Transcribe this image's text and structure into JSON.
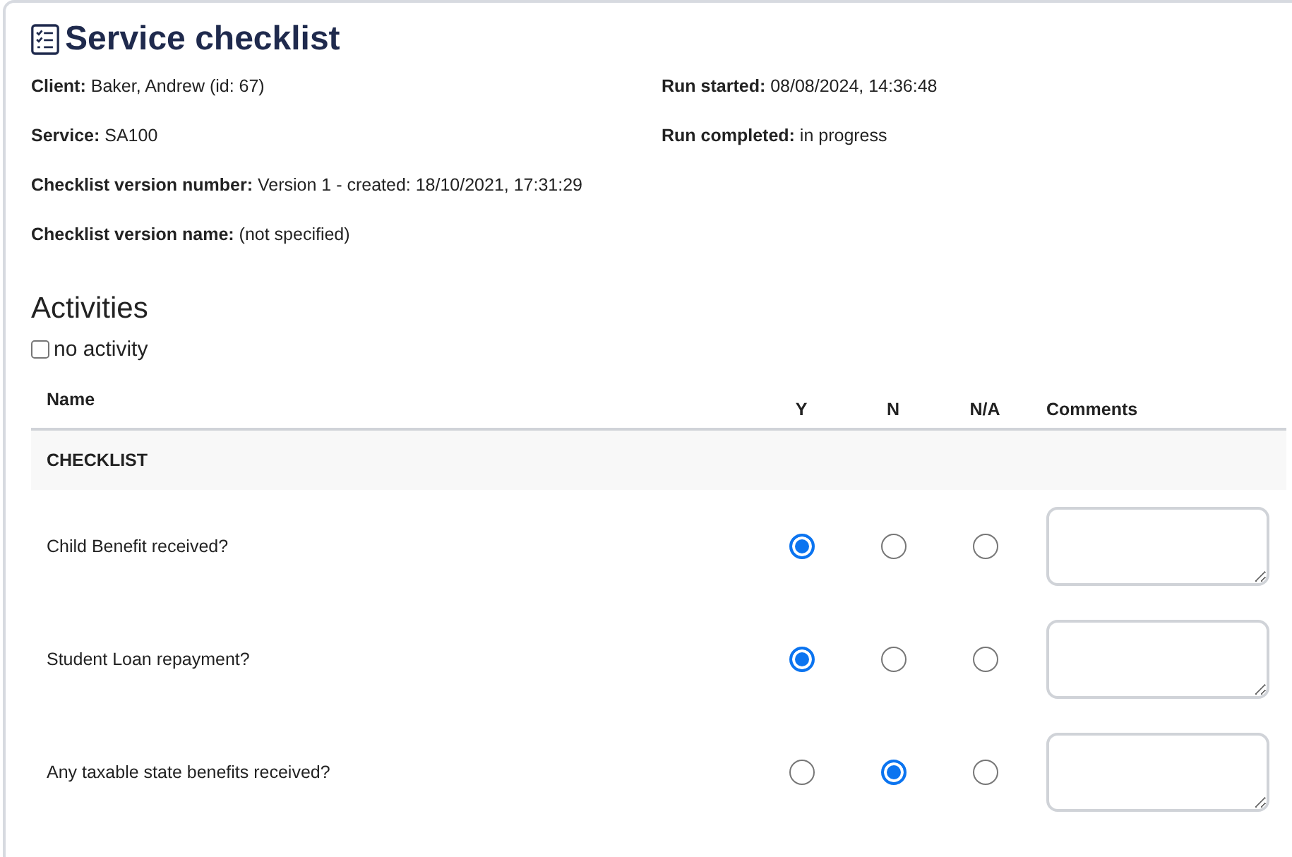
{
  "title": "Service checklist",
  "details_left": [
    {
      "label": "Client:",
      "value": "Baker, Andrew (id: 67)"
    },
    {
      "label": "Service:",
      "value": "SA100"
    },
    {
      "label": "Checklist version number:",
      "value": "Version 1 - created: 18/10/2021, 17:31:29"
    },
    {
      "label": "Checklist version name:",
      "value": "(not specified)"
    }
  ],
  "details_right": [
    {
      "label": "Run started:",
      "value": "08/08/2024, 14:36:48"
    },
    {
      "label": "Run completed:",
      "value": "in progress"
    }
  ],
  "activities": {
    "heading": "Activities",
    "no_activity": {
      "label": "no activity",
      "checked": false
    },
    "table": {
      "columns": [
        "Name",
        "Y",
        "N",
        "N/A",
        "Comments"
      ],
      "section": "CHECKLIST",
      "rows": [
        {
          "name": "Child Benefit received?",
          "choices": [
            {
              "selected": true
            },
            {
              "selected": false
            },
            {
              "selected": false
            }
          ]
        },
        {
          "name": "Student Loan repayment?",
          "choices": [
            {
              "selected": true
            },
            {
              "selected": false
            },
            {
              "selected": false
            }
          ]
        },
        {
          "name": "Any taxable state benefits received?",
          "choices": [
            {
              "selected": false
            },
            {
              "selected": true
            },
            {
              "selected": false
            }
          ]
        }
      ]
    }
  }
}
